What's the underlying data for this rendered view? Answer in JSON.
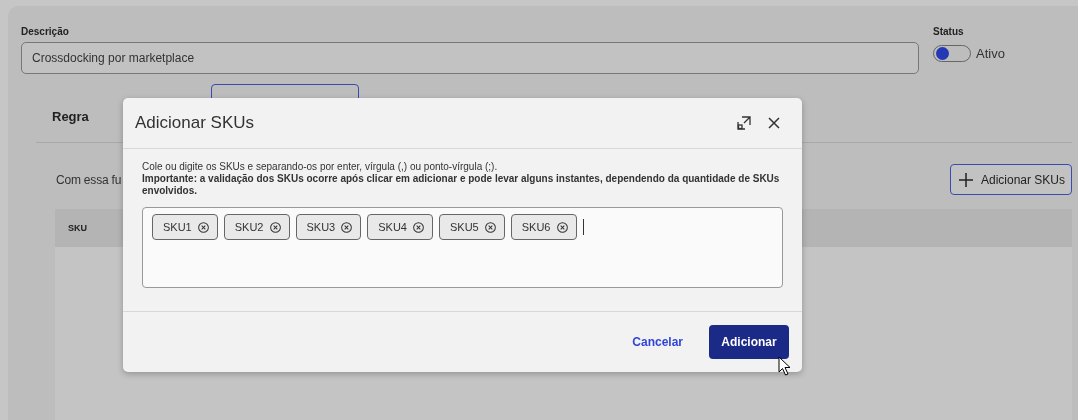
{
  "form": {
    "description_label": "Descrição",
    "description_value": "Crossdocking por marketplace",
    "status_label": "Status",
    "status_on": true,
    "status_text": "Ativo"
  },
  "tabs": [
    {
      "label": "Regra",
      "selected": false
    }
  ],
  "intro_text": "Com essa fu",
  "add_button": "Adicionar SKUs",
  "table": {
    "columns": [
      "SKU"
    ]
  },
  "dialog": {
    "title": "Adicionar SKUs",
    "hint": "Cole ou digite os SKUs e separando-os por enter, vírgula (,) ou ponto-vírgula (;).",
    "note": "Importante: a validação dos SKUs ocorre após clicar em adicionar e pode levar alguns instantes, dependendo da quantidade de SKUs envolvidos.",
    "chips": [
      "SKU1",
      "SKU2",
      "SKU3",
      "SKU4",
      "SKU5",
      "SKU6"
    ],
    "cancel": "Cancelar",
    "confirm": "Adicionar"
  }
}
